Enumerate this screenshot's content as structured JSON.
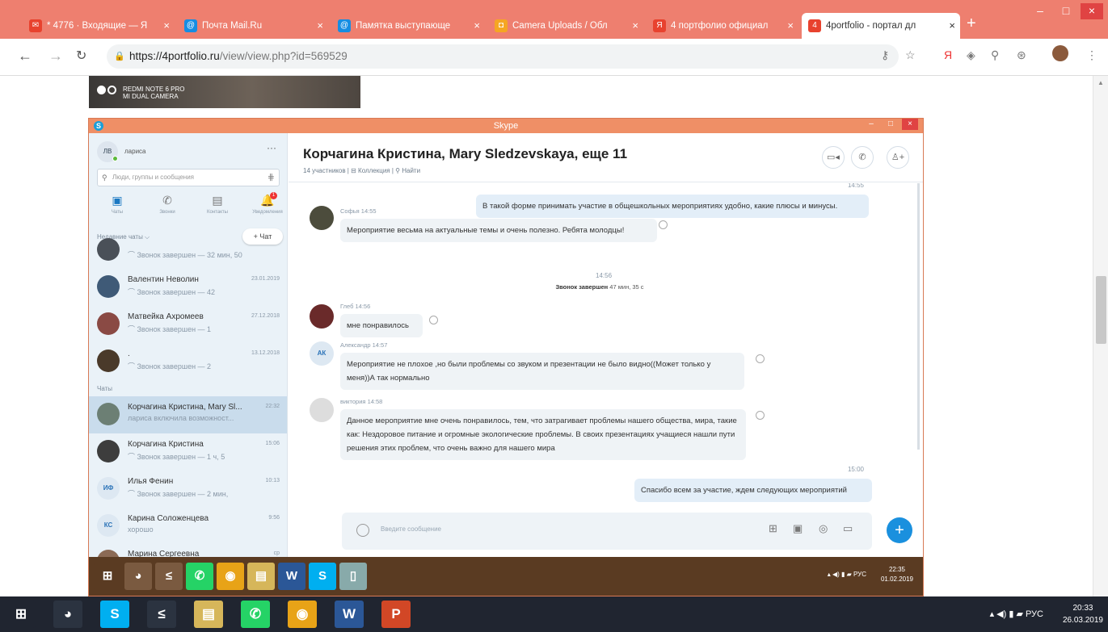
{
  "browser": {
    "tabs": [
      {
        "label": "* 4776 · Входящие — Я",
        "color": "#e8422e",
        "icon_text": "✉"
      },
      {
        "label": "Почта Mail.Ru",
        "color": "#168de2",
        "icon_text": "@"
      },
      {
        "label": "Памятка выступающе",
        "color": "#168de2",
        "icon_text": "@"
      },
      {
        "label": "Camera Uploads / Обл",
        "color": "#f5a623",
        "icon_text": "◘"
      },
      {
        "label": "4 портфолио официал",
        "color": "#e8422e",
        "icon_text": "Я"
      },
      {
        "label": "4portfolio - портал дл",
        "color": "#e8422e",
        "icon_text": "4"
      }
    ],
    "new_tab": "+",
    "url_host": "https://4portfolio.ru",
    "url_path": "/view/view.php?id=569529",
    "close_glyph": "×"
  },
  "photo": {
    "caption_line1": "REDMI NOTE 6 PRO",
    "caption_line2": "MI DUAL CAMERA"
  },
  "skype": {
    "window_title": "Skype",
    "user_initials": "ЛВ",
    "user_name": "лариса",
    "more": "···",
    "search_placeholder": "Люди, группы и сообщения",
    "nav": [
      {
        "label": "Чаты",
        "glyph": "▣"
      },
      {
        "label": "Звонки",
        "glyph": "✆"
      },
      {
        "label": "Контакты",
        "glyph": "▤"
      },
      {
        "label": "Уведомления",
        "glyph": "🔔"
      }
    ],
    "notif_badge": "1",
    "recent_header": "Недавние чаты ⌵",
    "new_chat": "+ Чат",
    "chats_header": "Чаты",
    "chats": [
      {
        "name": "",
        "sub": "⌒ Звонок завершен — 32 мин, 50",
        "time": "",
        "initials": "",
        "color": "#4a5058"
      },
      {
        "name": "Валентин Неволин",
        "sub": "⌒ Звонок завершен — 42",
        "time": "23.01.2019",
        "initials": "",
        "color": "#3f5a77"
      },
      {
        "name": "Матвейка Ахромеев",
        "sub": "⌒ Звонок завершен — 1",
        "time": "27.12.2018",
        "initials": "",
        "color": "#8a4a44"
      },
      {
        "name": ".",
        "sub": "⌒ Звонок завершен — 2",
        "time": "13.12.2018",
        "initials": "",
        "color": "#4a3a2a"
      },
      {
        "name": "Корчагина Кристина, Mary Sl...",
        "sub": "лариса включила возможност...",
        "time": "22:32",
        "initials": "",
        "color": "#6c7f74"
      },
      {
        "name": "Корчагина Кристина",
        "sub": "⌒ Звонок завершен — 1 ч, 5",
        "time": "15:06",
        "initials": "",
        "color": "#3d3d3d"
      },
      {
        "name": "Илья Фенин",
        "sub": "⌒ Звонок завершен — 2 мин,",
        "time": "10:13",
        "initials": "ИФ",
        "color": "#dde8f2"
      },
      {
        "name": "Карина Соложенцева",
        "sub": "хорошо",
        "time": "9:56",
        "initials": "КС",
        "color": "#dde8f2"
      },
      {
        "name": "Марина Сергеевна",
        "sub": "",
        "time": "ср",
        "initials": "",
        "color": "#8b6a55"
      }
    ],
    "conversation": {
      "title": "Корчагина Кристина, Mary Sledzevskaya, еще 11",
      "subtitle": "14 участников | ⊟ Коллекция | ⚲ Найти",
      "header_buttons": [
        "▭◂",
        "✆",
        "♙+"
      ],
      "messages": [
        {
          "type": "out",
          "time": "14:55",
          "text": "В такой форме принимать участие в общешкольных мероприятиях удобно, какие плюсы и минусы."
        },
        {
          "type": "in",
          "sender": "Софья 14:55",
          "text": "Мероприятие весьма на актуальные темы и очень полезно. Ребята молодцы!",
          "initials": "",
          "color": "#4c4c3c"
        },
        {
          "type": "call",
          "time": "14:56",
          "label": "Звонок завершен",
          "duration": "47 мин, 35 с"
        },
        {
          "type": "in",
          "sender": "Глеб 14:56",
          "text": "мне понравилось",
          "initials": "",
          "color": "#6a2a2a"
        },
        {
          "type": "in",
          "sender": "Александр 14:57",
          "text": "Мероприятие не плохое ,но были проблемы со звуком и презентации не было видно((Может только у меня))А так нормально",
          "initials": "АК",
          "color": "#dde8f2"
        },
        {
          "type": "in",
          "sender": "виктория 14:58",
          "text": "Данное мероприятие мне очень понравилось, тем, что затрагивает проблемы нашего общества, мира, такие как: Нездоровое питание и огромные экологические проблемы. В своих презентациях учащиеся нашли пути решения этих проблем, что очень важно для нашего мира",
          "initials": "",
          "color": "#ddd"
        },
        {
          "type": "out",
          "time": "15:00",
          "text": "Спасибо всем за участие, ждем  следующих мероприятий"
        }
      ],
      "composer_placeholder": "Введите сообщение",
      "composer_tools": [
        "⊞",
        "▣",
        "◎",
        "▭"
      ],
      "send": "+"
    },
    "taskbar": {
      "apps": [
        {
          "glyph": "⊞",
          "color": "#5a3b22"
        },
        {
          "glyph": "◕",
          "color": "#7a5a40"
        },
        {
          "glyph": "≤",
          "color": "#7a5a40"
        },
        {
          "glyph": "✆",
          "color": "#25d366"
        },
        {
          "glyph": "◉",
          "color": "#e8a317"
        },
        {
          "glyph": "▤",
          "color": "#d6b65a"
        },
        {
          "glyph": "W",
          "color": "#2b5797"
        },
        {
          "glyph": "S",
          "color": "#00aff0"
        },
        {
          "glyph": "▯",
          "color": "#8aa"
        }
      ],
      "tray": "▴ ◀) ▮ ▰ РУС",
      "time": "22:35",
      "date": "01.02.2019"
    }
  },
  "taskbar": {
    "apps": [
      {
        "glyph": "⊞",
        "color": "#202530"
      },
      {
        "glyph": "◕",
        "color": "#2b3340"
      },
      {
        "glyph": "S",
        "color": "#00aff0"
      },
      {
        "glyph": "≤",
        "color": "#2b3340"
      },
      {
        "glyph": "▤",
        "color": "#d6b65a"
      },
      {
        "glyph": "✆",
        "color": "#25d366"
      },
      {
        "glyph": "◉",
        "color": "#e8a317"
      },
      {
        "glyph": "W",
        "color": "#2b5797"
      },
      {
        "glyph": "P",
        "color": "#d24726"
      }
    ],
    "tray": "▴  ◀)  ▮  ▰  РУС",
    "time": "20:33",
    "date": "26.03.2019"
  }
}
